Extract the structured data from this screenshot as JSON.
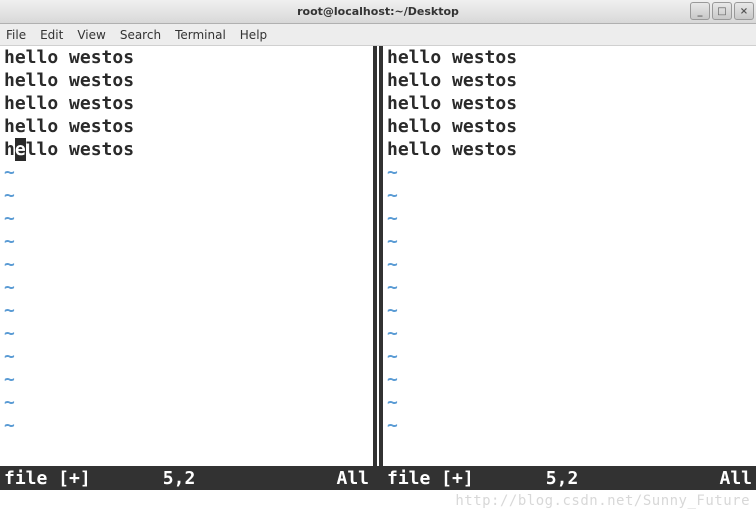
{
  "window": {
    "title": "root@localhost:~/Desktop"
  },
  "menu": {
    "file": "File",
    "edit": "Edit",
    "view": "View",
    "search": "Search",
    "terminal": "Terminal",
    "help": "Help"
  },
  "left_pane": {
    "lines": [
      "hello westos",
      "hello westos",
      "hello westos",
      "hello westos"
    ],
    "cursor_line": {
      "pre": "h",
      "cursor": "e",
      "post": "llo westos"
    },
    "tilde": "~",
    "status": {
      "filename": "file [+]",
      "position": "5,2",
      "percent": "All"
    }
  },
  "right_pane": {
    "lines": [
      "hello westos",
      "hello westos",
      "hello westos",
      "hello westos",
      "hello westos"
    ],
    "tilde": "~",
    "status": {
      "filename": "file [+]",
      "position": "5,2",
      "percent": "All"
    }
  },
  "watermark": "http://blog.csdn.net/Sunny_Future"
}
